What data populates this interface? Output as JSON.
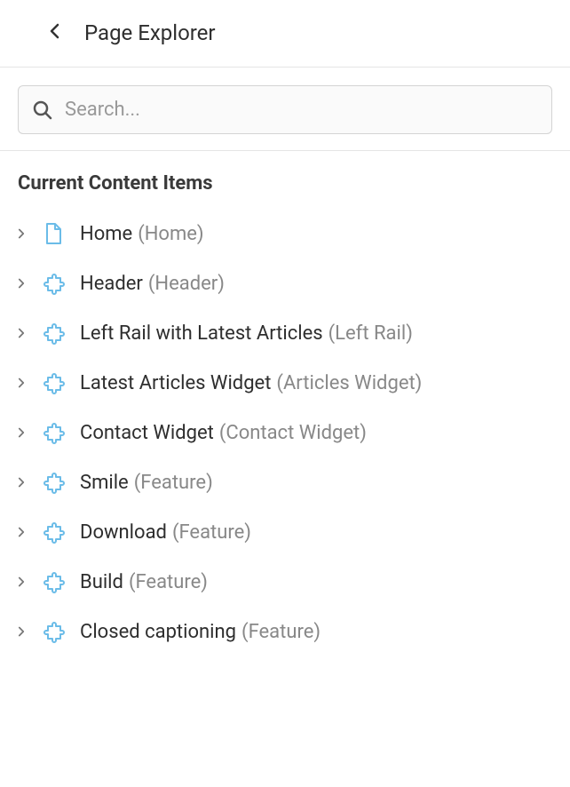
{
  "header": {
    "title": "Page Explorer"
  },
  "search": {
    "placeholder": "Search..."
  },
  "section": {
    "title": "Current Content Items"
  },
  "items": [
    {
      "label": "Home",
      "type": "Home",
      "icon": "file"
    },
    {
      "label": "Header",
      "type": "Header",
      "icon": "puzzle"
    },
    {
      "label": "Left Rail with Latest Articles",
      "type": "Left Rail",
      "icon": "puzzle"
    },
    {
      "label": "Latest Articles Widget",
      "type": "Articles Widget",
      "icon": "puzzle"
    },
    {
      "label": "Contact Widget",
      "type": "Contact Widget",
      "icon": "puzzle"
    },
    {
      "label": "Smile",
      "type": "Feature",
      "icon": "puzzle"
    },
    {
      "label": "Download",
      "type": "Feature",
      "icon": "puzzle"
    },
    {
      "label": "Build",
      "type": "Feature",
      "icon": "puzzle"
    },
    {
      "label": "Closed captioning",
      "type": "Feature",
      "icon": "puzzle"
    }
  ]
}
